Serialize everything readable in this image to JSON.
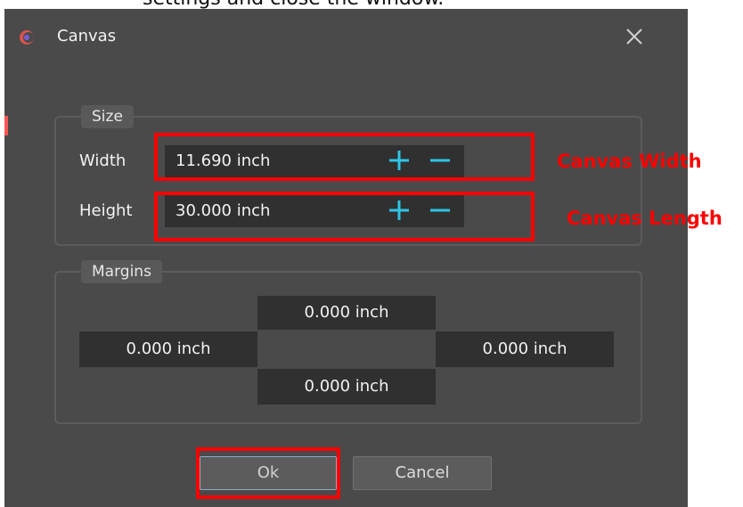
{
  "caption": "settings and close the window.",
  "dialog": {
    "title": "Canvas",
    "app_icon": "canvas-app-icon",
    "close_icon": "close-icon"
  },
  "size_group": {
    "label": "Size",
    "width_label": "Width",
    "width_value": "11.690 inch",
    "height_label": "Height",
    "height_value": "30.000 inch",
    "increment_icon": "plus-icon",
    "decrement_icon": "minus-icon"
  },
  "margins_group": {
    "label": "Margins",
    "top": "0.000 inch",
    "left": "0.000 inch",
    "right": "0.000 inch",
    "bottom": "0.000 inch"
  },
  "buttons": {
    "ok": "Ok",
    "cancel": "Cancel"
  },
  "annotations": {
    "width": "Canvas Width",
    "length": "Canvas Length"
  },
  "colors": {
    "dialog_bg": "#4a4a4a",
    "field_bg": "#303030",
    "accent_cyan": "#2ec4e6",
    "highlight_red": "#ff0000"
  }
}
